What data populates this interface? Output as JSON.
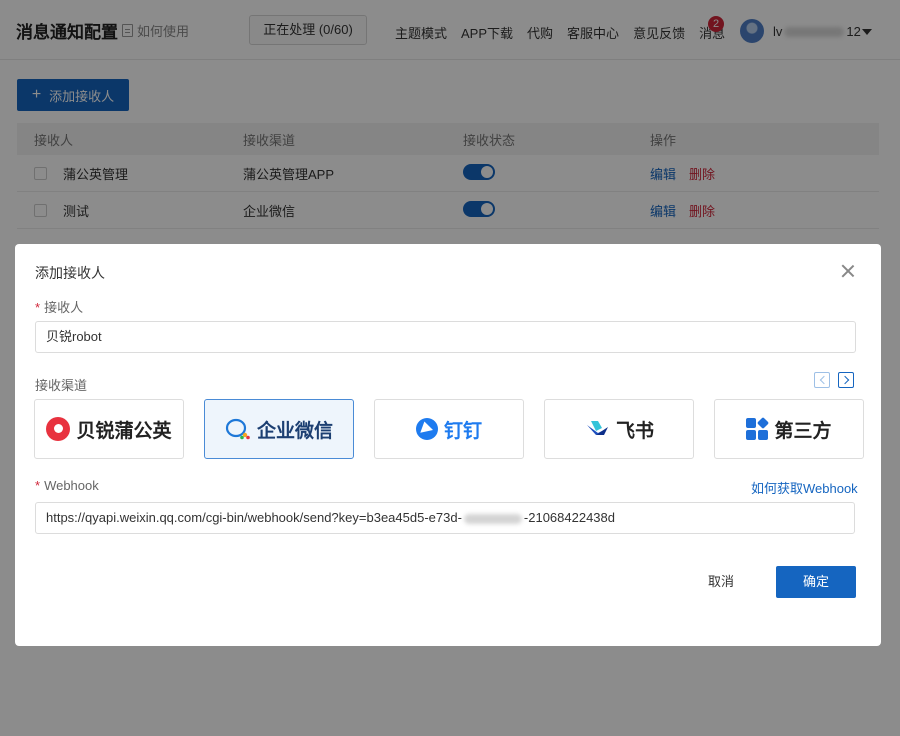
{
  "header": {
    "title": "消息通知配置",
    "howto_label": "如何使用",
    "processing_label": "正在处理 (0/60)",
    "nav": [
      "主题模式",
      "APP下载",
      "代购",
      "客服中心",
      "意见反馈",
      "消息"
    ],
    "message_badge": "2",
    "username_prefix": "lv",
    "username_suffix": "12"
  },
  "toolbar": {
    "add_label": "添加接收人"
  },
  "table": {
    "columns": [
      "接收人",
      "接收渠道",
      "接收状态",
      "操作"
    ],
    "rows": [
      {
        "name": "蒲公英管理",
        "channel": "蒲公英管理APP",
        "enabled": true,
        "edit": "编辑",
        "delete": "删除"
      },
      {
        "name": "测试",
        "channel": "企业微信",
        "enabled": true,
        "edit": "编辑",
        "delete": "删除"
      }
    ]
  },
  "modal": {
    "title": "添加接收人",
    "receiver_label": "接收人",
    "receiver_value": "贝锐robot",
    "channel_label": "接收渠道",
    "channels": [
      {
        "label": "贝锐蒲公英",
        "icon": "beirui-icon",
        "selected": false
      },
      {
        "label": "企业微信",
        "icon": "wechat-work-icon",
        "selected": true
      },
      {
        "label": "钉钉",
        "icon": "dingtalk-icon",
        "selected": false
      },
      {
        "label": "飞书",
        "icon": "feishu-icon",
        "selected": false
      },
      {
        "label": "第三方",
        "icon": "third-party-icon",
        "selected": false
      }
    ],
    "webhook_label": "Webhook",
    "webhook_help": "如何获取Webhook",
    "webhook_prefix": "https://qyapi.weixin.qq.com/cgi-bin/webhook/send?key=b3ea45d5-e73d-",
    "webhook_suffix": "-21068422438d",
    "cancel_label": "取消",
    "ok_label": "确定"
  },
  "colors": {
    "primary": "#1565c0",
    "danger": "#d0263a",
    "selected_bg": "#eef5fc"
  }
}
